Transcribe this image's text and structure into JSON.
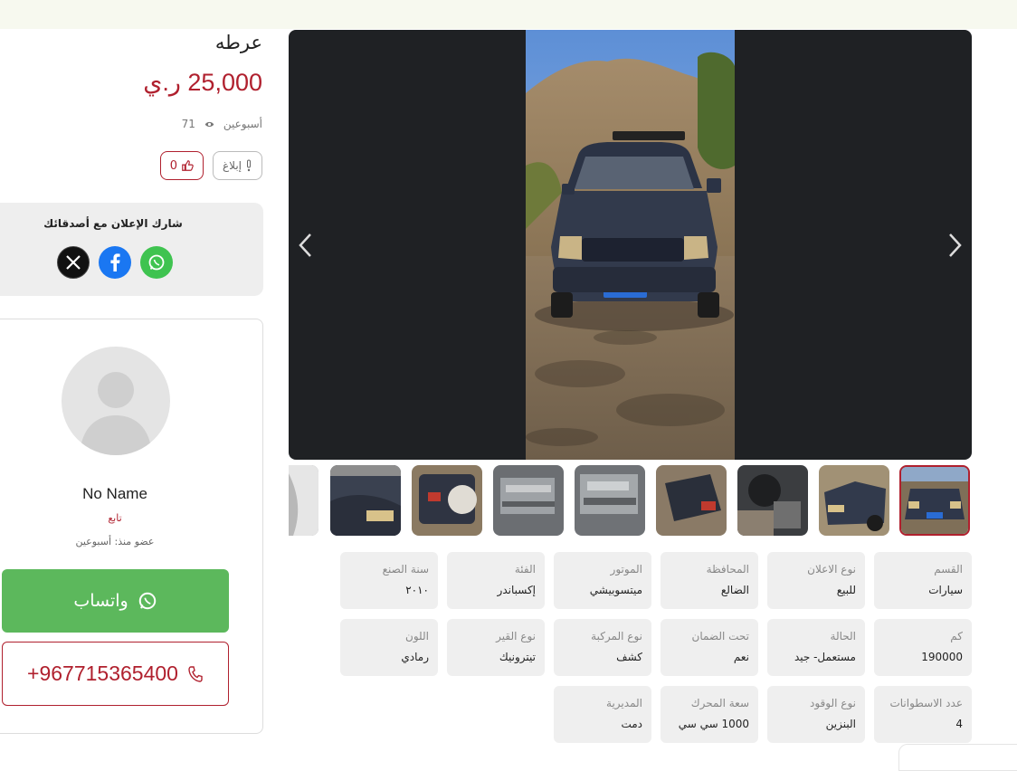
{
  "listing": {
    "title": "عرطه",
    "price": "25,000 ر.ي",
    "posted_ago": "أسبوعين",
    "views": "71",
    "report_label": "إبلاغ",
    "likes": "0"
  },
  "share": {
    "title": "شارك الإعلان مع أصدقائك",
    "icons": [
      "x-icon",
      "facebook-icon",
      "whatsapp-icon"
    ]
  },
  "seller": {
    "name": "No Name",
    "role": "تابع",
    "member_since": "عضو منذ: أسبوعين",
    "whatsapp_label": "واتساب",
    "phone": "+967715365400"
  },
  "specs": [
    {
      "label": "القسم",
      "value": "سيارات"
    },
    {
      "label": "نوع الاعلان",
      "value": "للبيع"
    },
    {
      "label": "المحافظة",
      "value": "الضالع"
    },
    {
      "label": "الموتور",
      "value": "ميتسوبيشي"
    },
    {
      "label": "الفئة",
      "value": "إكسباندر"
    },
    {
      "label": "سنة الصنع",
      "value": "٢٠١٠"
    },
    {
      "label": "كم",
      "value": "190000"
    },
    {
      "label": "الحالة",
      "value": "مستعمل- جيد"
    },
    {
      "label": "تحت الضمان",
      "value": "نعم"
    },
    {
      "label": "نوع المركبة",
      "value": "كشف"
    },
    {
      "label": "نوع القير",
      "value": "تيترونيك"
    },
    {
      "label": "اللون",
      "value": "رمادي"
    },
    {
      "label": "عدد الاسطوانات",
      "value": "4"
    },
    {
      "label": "نوع الوقود",
      "value": "البنزين"
    },
    {
      "label": "سعة المحرك",
      "value": "1000 سي سي"
    },
    {
      "label": "المديرية",
      "value": "دمت"
    }
  ],
  "colors": {
    "accent": "#b0202e",
    "whatsapp": "#5cb85c",
    "gallery_bg": "#1f2124",
    "spec_bg": "#efefef"
  }
}
